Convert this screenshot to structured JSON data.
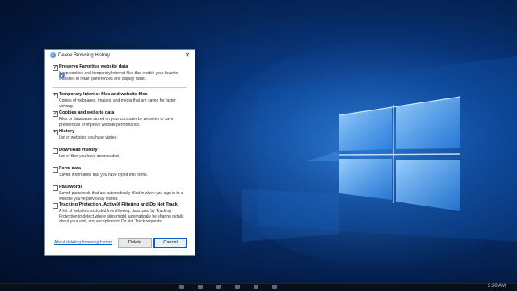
{
  "dialog": {
    "title": "Delete Browsing History",
    "items": [
      {
        "label": "Preserve Favorites website data",
        "checked": true,
        "desc": "Keep cookies and temporary Internet files that enable your favorite websites to retain preferences and display faster."
      },
      {
        "label": "Temporary Internet files and website files",
        "checked": true,
        "desc": "Copies of webpages, images, and media that are saved for faster viewing."
      },
      {
        "label": "Cookies and website data",
        "checked": true,
        "desc": "Files or databases stored on your computer by websites to save preferences or improve website performance."
      },
      {
        "label": "History",
        "checked": true,
        "desc": "List of websites you have visited."
      },
      {
        "label": "Download History",
        "checked": false,
        "desc": "List of files you have downloaded."
      },
      {
        "label": "Form data",
        "checked": false,
        "desc": "Saved information that you have typed into forms."
      },
      {
        "label": "Passwords",
        "checked": false,
        "desc": "Saved passwords that are automatically filled in when you sign in to a website you've previously visited."
      },
      {
        "label": "Tracking Protection, ActiveX Filtering and Do Not Track",
        "checked": false,
        "desc": "A list of websites excluded from filtering, data used by Tracking Protection to detect where sites might automatically be sharing details about your visit, and exceptions to Do Not Track requests."
      }
    ],
    "about_link": "About deleting browsing history",
    "delete_label": "Delete",
    "cancel_label": "Cancel",
    "check_glyph": "✓"
  },
  "taskbar": {
    "clock": "3:20 AM"
  }
}
